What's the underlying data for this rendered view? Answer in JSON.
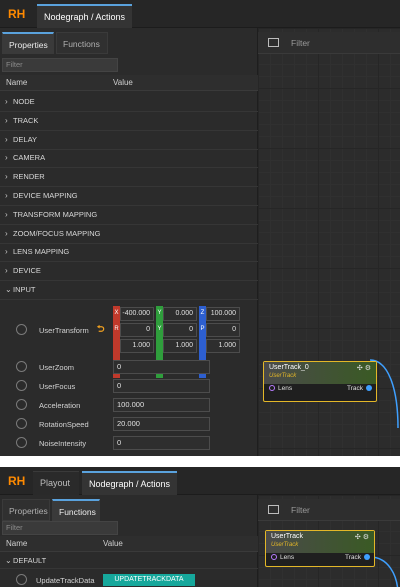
{
  "colors": {
    "accent_tab": "#5aa2dd",
    "logo": "#ff8a00",
    "node_border": "#e3b728",
    "action_button": "#16a89c",
    "x_axis": "#c0392b",
    "y_axis": "#2f9e3c",
    "z_axis": "#2d5fd0"
  },
  "logo_text": "RH",
  "panel1": {
    "doc_tab": "Nodegraph / Actions",
    "tabs": [
      "Properties",
      "Functions"
    ],
    "filter_placeholder": "Filter",
    "graph_filter_placeholder": "Filter",
    "columns": {
      "name": "Name",
      "value": "Value"
    },
    "categories": [
      "NODE",
      "TRACK",
      "DELAY",
      "CAMERA",
      "RENDER",
      "DEVICE MAPPING",
      "TRANSFORM MAPPING",
      "ZOOM/FOCUS MAPPING",
      "LENS MAPPING",
      "DEVICE",
      "INPUT"
    ],
    "user_transform": {
      "label": "UserTransform",
      "reset_icon": "undo-arrow-icon",
      "x_axis": [
        "X",
        "R",
        ""
      ],
      "y_axis": [
        "Y",
        "Y",
        ""
      ],
      "z_axis": [
        "Z",
        "P",
        ""
      ],
      "x": [
        "-400.000",
        "0",
        "1.000"
      ],
      "y": [
        "0.000",
        "0",
        "1.000"
      ],
      "z": [
        "100.000",
        "0",
        "1.000"
      ]
    },
    "inputs": [
      {
        "label": "UserZoom",
        "value": "0"
      },
      {
        "label": "UserFocus",
        "value": "0"
      },
      {
        "label": "Acceleration",
        "value": "100.000"
      },
      {
        "label": "RotationSpeed",
        "value": "20.000"
      },
      {
        "label": "NoiseIntensity",
        "value": "0"
      }
    ],
    "node": {
      "title": "UserTrack_0",
      "subtitle": "UserTrack",
      "input_pin": "Lens",
      "output_pin": "Track"
    }
  },
  "panel2": {
    "doc_tabs": [
      "Playout",
      "Nodegraph / Actions"
    ],
    "tabs": [
      "Properties",
      "Functions"
    ],
    "filter_placeholder": "Filter",
    "graph_filter_placeholder": "Filter",
    "columns": {
      "name": "Name",
      "value": "Value"
    },
    "category": "DEFAULT",
    "function_row": {
      "label": "UpdateTrackData",
      "button": "UPDATETRACKDATA"
    },
    "node": {
      "title": "UserTrack",
      "subtitle": "UserTrack",
      "input_pin": "Lens",
      "output_pin": "Track"
    }
  }
}
